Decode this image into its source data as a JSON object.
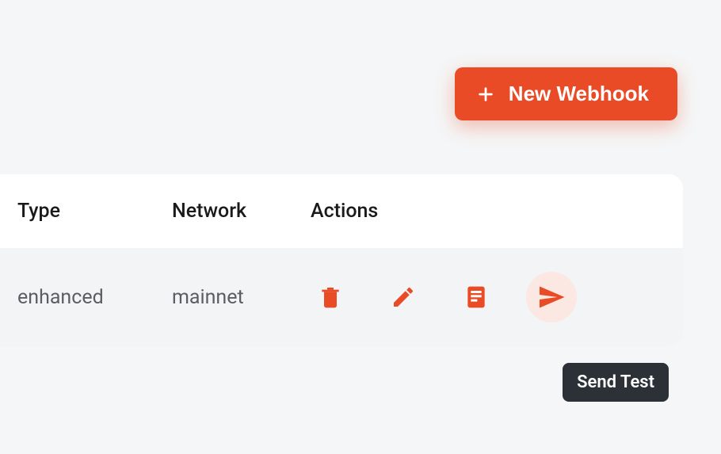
{
  "colors": {
    "accent": "#e84b26",
    "accent_bg": "#fce8e3",
    "tooltip_bg": "#2b3137"
  },
  "button": {
    "new_webhook_label": "New Webhook"
  },
  "table": {
    "headers": {
      "type": "Type",
      "network": "Network",
      "actions": "Actions"
    },
    "row": {
      "type": "enhanced",
      "network": "mainnet"
    }
  },
  "tooltip": {
    "send_test": "Send Test"
  },
  "icons": {
    "plus": "plus-icon",
    "trash": "trash-icon",
    "edit": "pencil-icon",
    "doc": "document-icon",
    "send": "send-icon"
  }
}
